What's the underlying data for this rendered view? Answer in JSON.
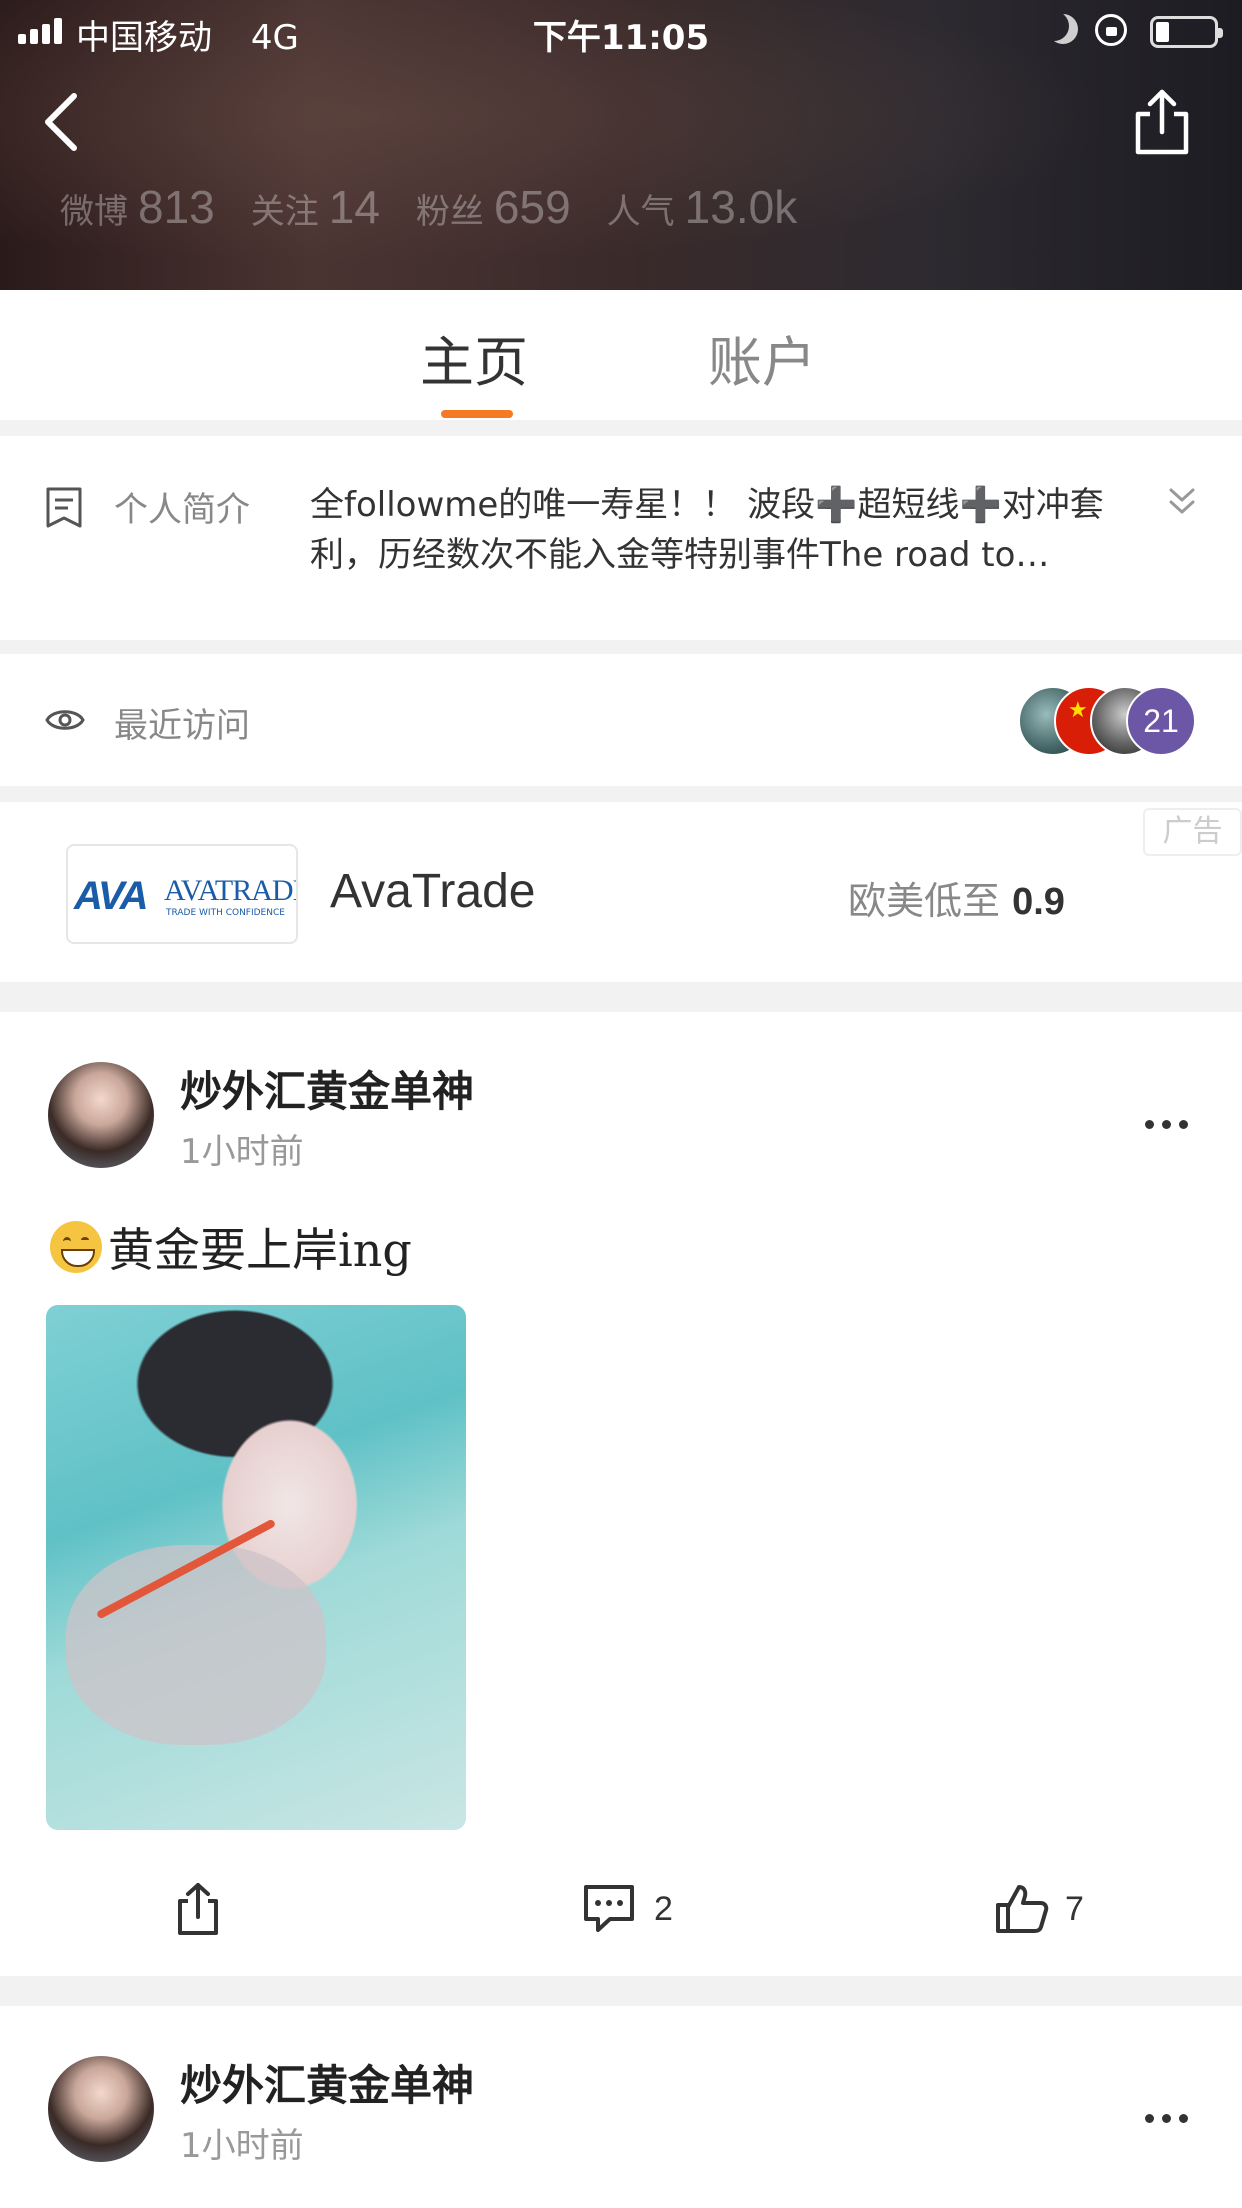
{
  "status_bar": {
    "carrier": "中国移动",
    "network": "4G",
    "time": "下午11:05"
  },
  "profile_stats": [
    {
      "label": "微博",
      "value": "813"
    },
    {
      "label": "关注",
      "value": "14"
    },
    {
      "label": "粉丝",
      "value": "659"
    },
    {
      "label": "人气",
      "value": "13.0k"
    }
  ],
  "tabs": [
    {
      "label": "主页",
      "active": true
    },
    {
      "label": "账户",
      "active": false
    }
  ],
  "accent_color": "#f47a24",
  "bio": {
    "label": "个人简介",
    "text": "全followme的唯一寿星！！ 波段➕超短线➕对冲套利，历经数次不能入金等特别事件The road to…"
  },
  "recent_visitors": {
    "label": "最近访问",
    "count": "21"
  },
  "ad": {
    "badge": "广告",
    "logo_mark": "AVA",
    "logo_word": "AVATRADE",
    "logo_tagline": "TRADE WITH CONFIDENCE",
    "name": "AvaTrade",
    "desc_prefix": "欧美低至",
    "desc_value": "0.9"
  },
  "posts": [
    {
      "author": "炒外汇黄金单神",
      "time": "1小时前",
      "text": "黄金要上岸ing",
      "comments": "2",
      "likes": "7"
    },
    {
      "author": "炒外汇黄金单神",
      "time": "1小时前"
    }
  ]
}
